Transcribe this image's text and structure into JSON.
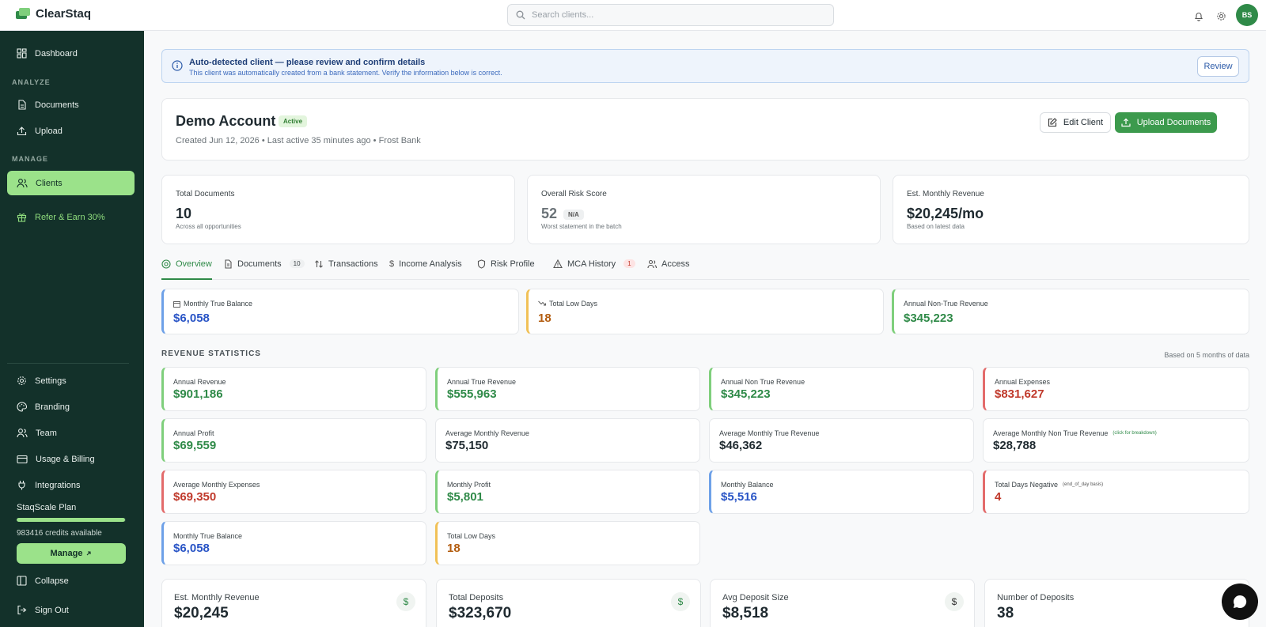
{
  "app": {
    "name": "ClearStaq"
  },
  "search": {
    "placeholder": "Search clients..."
  },
  "user": {
    "initials": "BS"
  },
  "sidebar": {
    "dashboard": "Dashboard",
    "analyze_section": "ANALYZE",
    "documents": "Documents",
    "upload": "Upload",
    "manage_section": "MANAGE",
    "clients": "Clients",
    "refer": "Refer & Earn 30%",
    "settings": "Settings",
    "branding": "Branding",
    "team": "Team",
    "usage_billing": "Usage & Billing",
    "integrations": "Integrations",
    "plan_name": "StaqScale Plan",
    "plan_usage_fraction": 0.99,
    "credits": "983416 credits available",
    "manage_label": "Manage",
    "collapse": "Collapse",
    "sign_out": "Sign Out"
  },
  "banner": {
    "title": "Auto-detected client — please review and confirm details",
    "subtitle": "This client was automatically created from a bank statement. Verify the information below is correct.",
    "review_label": "Review"
  },
  "client": {
    "name": "Demo Account",
    "status": "Active",
    "meta": "Created Jun 12, 2026 • Last active 35 minutes ago • Frost Bank",
    "edit_label": "Edit Client",
    "upload_label": "Upload Documents"
  },
  "kpis": [
    {
      "label": "Total Documents",
      "value": "10",
      "sub": "Across all opportunities"
    },
    {
      "label": "Overall Risk Score",
      "value": "52",
      "badge": "N/A",
      "sub": "Worst statement in the batch"
    },
    {
      "label": "Est. Monthly Revenue",
      "value": "$20,245/mo",
      "sub": "Based on latest data"
    }
  ],
  "tabs": [
    {
      "label": "Overview"
    },
    {
      "label": "Documents",
      "count": "10"
    },
    {
      "label": "Transactions"
    },
    {
      "label": "Income Analysis"
    },
    {
      "label": "Risk Profile"
    },
    {
      "label": "MCA History",
      "count": "1"
    },
    {
      "label": "Access"
    }
  ],
  "summary": [
    {
      "label": "Monthly True Balance",
      "value": "$6,058"
    },
    {
      "label": "Total Low Days",
      "value": "18"
    },
    {
      "label": "Annual Non-True Revenue",
      "value": "$345,223"
    }
  ],
  "revenue_stats": {
    "title": "REVENUE STATISTICS",
    "note": "Based on 5 months of data",
    "items": [
      {
        "label": "Annual Revenue",
        "value": "$901,186"
      },
      {
        "label": "Annual True Revenue",
        "value": "$555,963"
      },
      {
        "label": "Annual Non True Revenue",
        "value": "$345,223"
      },
      {
        "label": "Annual Expenses",
        "value": "$831,627"
      },
      {
        "label": "Annual Profit",
        "value": "$69,559"
      },
      {
        "label": "Average Monthly Revenue",
        "value": "$75,150"
      },
      {
        "label": "Average Monthly True Revenue",
        "value": "$46,362"
      },
      {
        "label": "Average Monthly Non True Revenue",
        "note": "(click for breakdown)",
        "value": "$28,788"
      },
      {
        "label": "Average Monthly Expenses",
        "value": "$69,350"
      },
      {
        "label": "Monthly Profit",
        "value": "$5,801"
      },
      {
        "label": "Monthly Balance",
        "value": "$5,516"
      },
      {
        "label": "Total Days Negative",
        "note": "(end_of_day basis)",
        "value": "4"
      },
      {
        "label": "Monthly True Balance",
        "value": "$6,058"
      },
      {
        "label": "Total Low Days",
        "value": "18"
      }
    ]
  },
  "bottom_cards": [
    {
      "label": "Est. Monthly Revenue",
      "value": "$20,245",
      "icon": "$"
    },
    {
      "label": "Total Deposits",
      "value": "$323,670",
      "icon": "$"
    },
    {
      "label": "Avg Deposit Size",
      "value": "$8,518",
      "icon": "$"
    },
    {
      "label": "Number of Deposits",
      "value": "38"
    }
  ],
  "colors": {
    "brand": "#2f8a48",
    "sidebar": "#13312a",
    "accent": "#9be28a"
  }
}
